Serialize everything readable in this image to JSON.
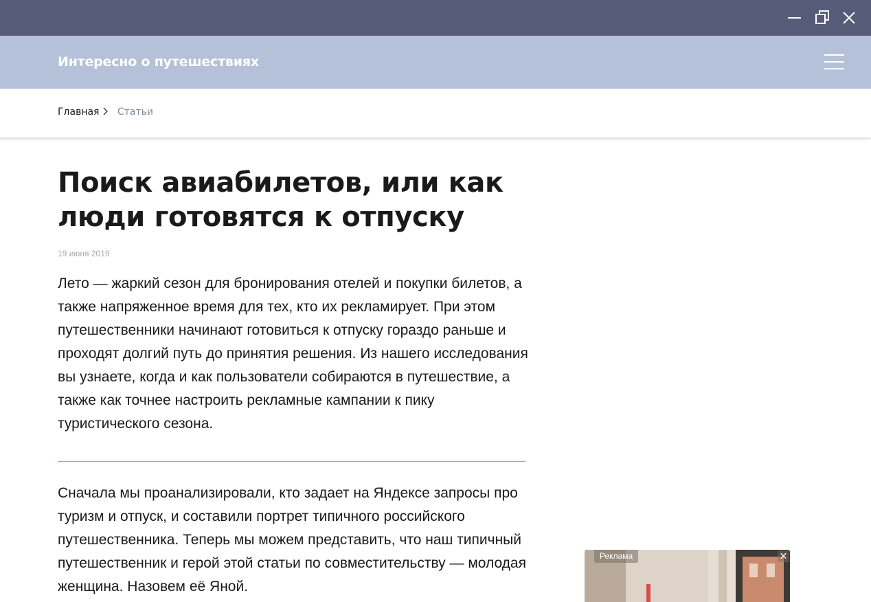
{
  "window": {
    "minimize_icon": "minimize-icon",
    "maximize_icon": "restore-icon",
    "close_icon": "close-icon",
    "titlebar_color": "#565b78"
  },
  "header": {
    "site_title": "Интересно о путешествиях",
    "menu_icon": "hamburger-menu-icon",
    "background_color": "#b5c1d8"
  },
  "breadcrumbs": {
    "home": "Главная",
    "separator_icon": "chevron-right-icon",
    "current": "Статьи"
  },
  "article": {
    "title": "Поиск авиабилетов, или как люди готовятся к отпуску",
    "date": "19 июня 2019",
    "lead": "Лето — жаркий сезон для бронирования отелей и покупки билетов, а также напряженное время для тех, кто их рекламирует. При этом путешественники начинают готовиться к отпуску гораздо раньше и проходят долгий путь до принятия решения. Из нашего исследования вы узнаете, когда и как пользователи собираются в путешествие, а также как точнее настроить рекламные кампании к пику туристического сезона.",
    "body": "Сначала мы проанализировали, кто задает на Яндексе запросы про туризм и отпуск, и составили портрет типичного российского путешественника. Теперь мы можем представить, что наш типичный путешественник и герой этой статьи по совместительству — молодая женщина. Назовем её Яной.",
    "divider_color": "#c58fc9"
  },
  "ad": {
    "label": "Реклама",
    "close_label": "✕"
  }
}
